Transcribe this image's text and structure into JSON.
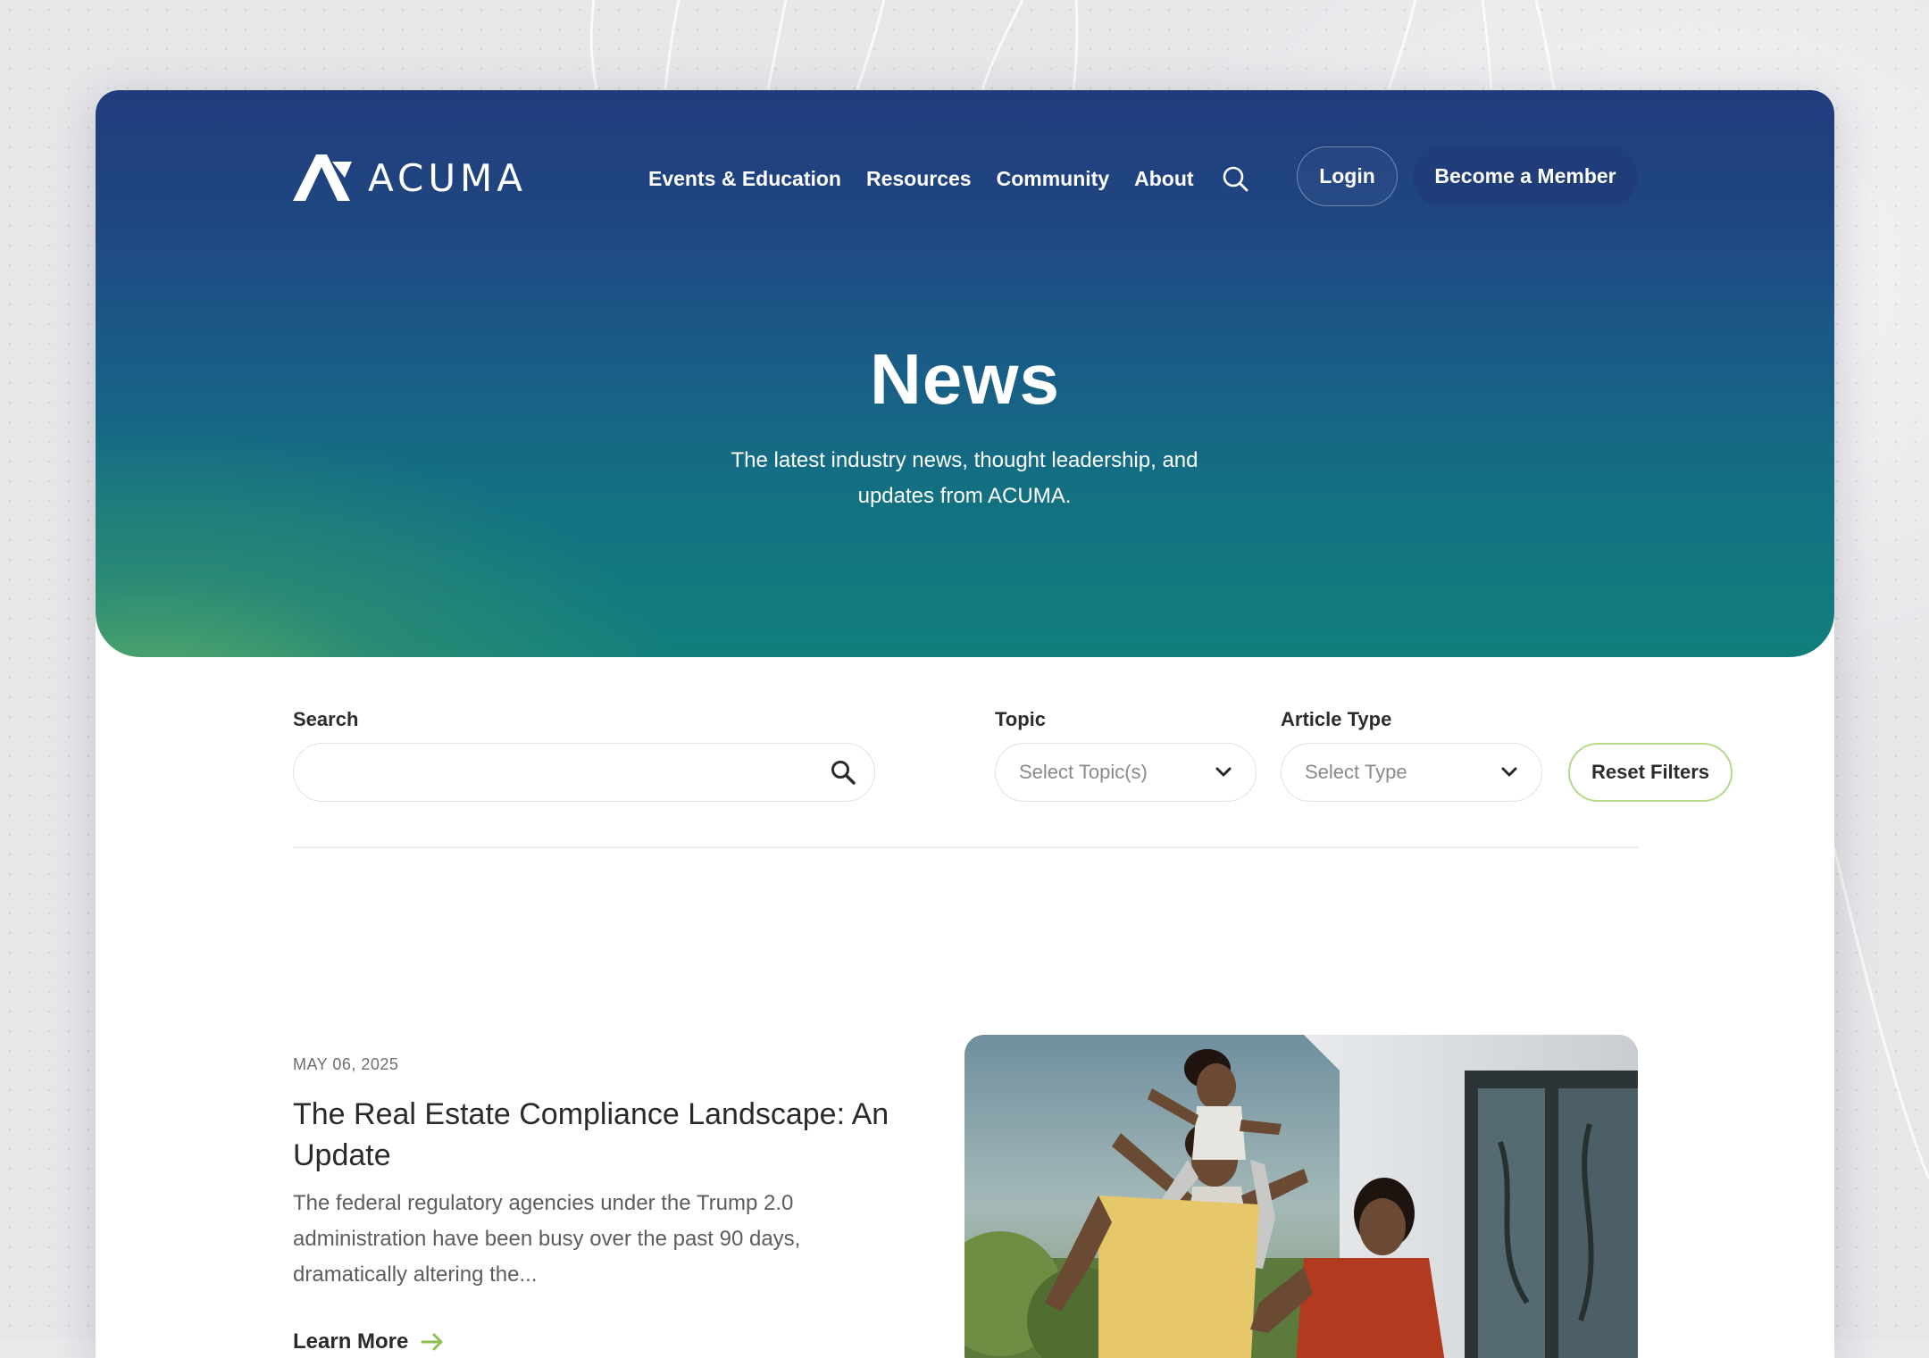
{
  "brand": {
    "name": "ACUMA",
    "logo_icon": "acuma-logo-icon",
    "accent": "#1f3d78",
    "highlight": "#b6d98a",
    "green_arrow": "#8cc152"
  },
  "nav": {
    "items": [
      {
        "label": "Events & Education"
      },
      {
        "label": "Resources"
      },
      {
        "label": "Community"
      },
      {
        "label": "About"
      }
    ],
    "search_icon": "search-icon",
    "login_label": "Login",
    "member_label": "Become a Member"
  },
  "hero": {
    "title": "News",
    "subtitle": "The latest industry news, thought leadership, and updates from ACUMA."
  },
  "filters": {
    "search_label": "Search",
    "search_value": "",
    "topic_label": "Topic",
    "topic_placeholder": "Select Topic(s)",
    "type_label": "Article Type",
    "type_placeholder": "Select Type",
    "reset_label": "Reset Filters"
  },
  "articles": [
    {
      "date": "MAY 06, 2025",
      "title": "The Real Estate Compliance Landscape: An Update",
      "excerpt": "The federal regulatory agencies under the Trump 2.0 administration have been busy over the past 90 days, dramatically altering the...",
      "link_label": "Learn More",
      "image": "family-outdoors-photo"
    }
  ]
}
